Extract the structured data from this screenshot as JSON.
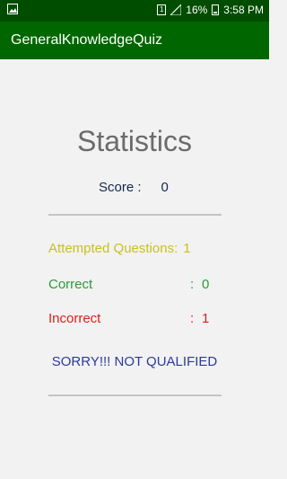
{
  "status_bar": {
    "sim_badge": "1",
    "battery_percent": "16%",
    "time": "3:58 PM"
  },
  "app_bar": {
    "title": "GeneralKnowledgeQuiz"
  },
  "screen": {
    "title": "Statistics",
    "score_label": "Score  :",
    "score_value": "0",
    "attempted_label": "Attempted Questions:",
    "attempted_value": "1",
    "correct_label": "Correct",
    "correct_value": "0",
    "incorrect_label": "Incorrect",
    "incorrect_value": "1",
    "colon": ":",
    "verdict": "SORRY!!! NOT QUALIFIED"
  },
  "colors": {
    "app_bar": "#006600",
    "status_bar": "#004d00",
    "attempted": "#c9bf22",
    "correct": "#2a9a3a",
    "incorrect": "#e21b1b",
    "verdict": "#2b3b9a"
  }
}
